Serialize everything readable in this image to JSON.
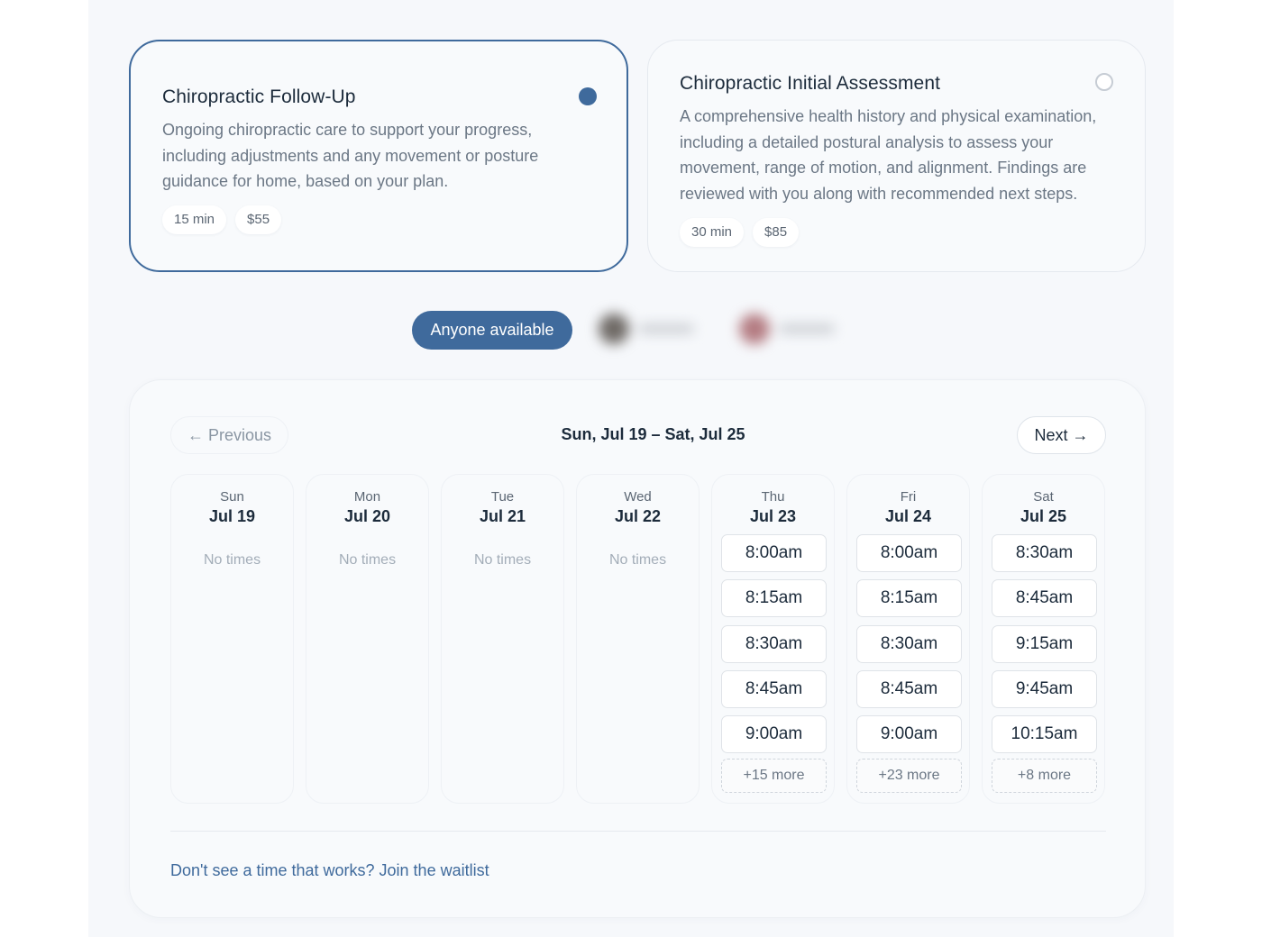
{
  "services": [
    {
      "title": "Chiropractic Follow-Up",
      "description": "Ongoing chiropractic care to support your progress, including adjustments and any movement or posture guidance for home, based on your plan.",
      "duration": "15 min",
      "price": "$55",
      "selected": true
    },
    {
      "title": "Chiropractic Initial Assessment",
      "description": "A comprehensive health history and physical examination, including a detailed postural analysis to assess your movement, range of motion, and alignment. Findings are reviewed with you along with recommended next steps.",
      "duration": "30 min",
      "price": "$85",
      "selected": false
    }
  ],
  "staff": {
    "anyone_label": "Anyone available"
  },
  "calendar": {
    "prev_label": "← Previous",
    "next_label": "Next →",
    "range_label": "Sun, Jul 19 – Sat, Jul 25",
    "no_times_label": "No times",
    "days": [
      {
        "name": "Sun",
        "date": "Jul 19",
        "slots": [],
        "more": ""
      },
      {
        "name": "Mon",
        "date": "Jul 20",
        "slots": [],
        "more": ""
      },
      {
        "name": "Tue",
        "date": "Jul 21",
        "slots": [],
        "more": ""
      },
      {
        "name": "Wed",
        "date": "Jul 22",
        "slots": [],
        "more": ""
      },
      {
        "name": "Thu",
        "date": "Jul 23",
        "slots": [
          "8:00am",
          "8:15am",
          "8:30am",
          "8:45am",
          "9:00am"
        ],
        "more": "+15 more"
      },
      {
        "name": "Fri",
        "date": "Jul 24",
        "slots": [
          "8:00am",
          "8:15am",
          "8:30am",
          "8:45am",
          "9:00am"
        ],
        "more": "+23 more"
      },
      {
        "name": "Sat",
        "date": "Jul 25",
        "slots": [
          "8:30am",
          "8:45am",
          "9:15am",
          "9:45am",
          "10:15am"
        ],
        "more": "+8 more"
      }
    ],
    "waitlist_label": "Don't see a time that works? Join the waitlist"
  },
  "colors": {
    "accent": "#3f6a9c",
    "text": "#1c2b3b",
    "muted": "#6b7785"
  }
}
